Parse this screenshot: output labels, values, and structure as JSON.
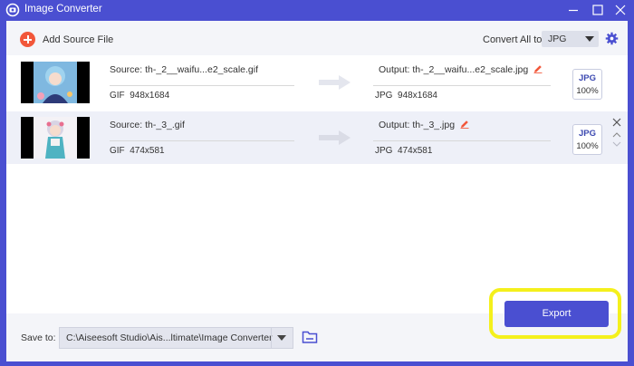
{
  "app": {
    "title": "Image Converter"
  },
  "toolbar": {
    "add_label": "Add Source File",
    "convert_all_label": "Convert All to:",
    "convert_all_value": "JPG"
  },
  "files": [
    {
      "source": "Source: th-_2__waifu...e2_scale.gif",
      "source_format": "GIF",
      "source_dims": "948x1684",
      "output": "Output: th-_2__waifu...e2_scale.jpg",
      "output_format": "JPG",
      "output_dims": "948x1684",
      "badge_format": "JPG",
      "badge_quality": "100%"
    },
    {
      "source": "Source: th-_3_.gif",
      "source_format": "GIF",
      "source_dims": "474x581",
      "output": "Output: th-_3_.jpg",
      "output_format": "JPG",
      "output_dims": "474x581",
      "badge_format": "JPG",
      "badge_quality": "100%"
    }
  ],
  "footer": {
    "save_label": "Save to:",
    "save_path": "C:\\Aiseesoft Studio\\Ais...ltimate\\Image Converter",
    "export_label": "Export"
  },
  "colors": {
    "accent": "#4a4fd1",
    "add_icon": "#f2573a",
    "edit_icon": "#f2573a",
    "highlight": "#f4f01c"
  }
}
